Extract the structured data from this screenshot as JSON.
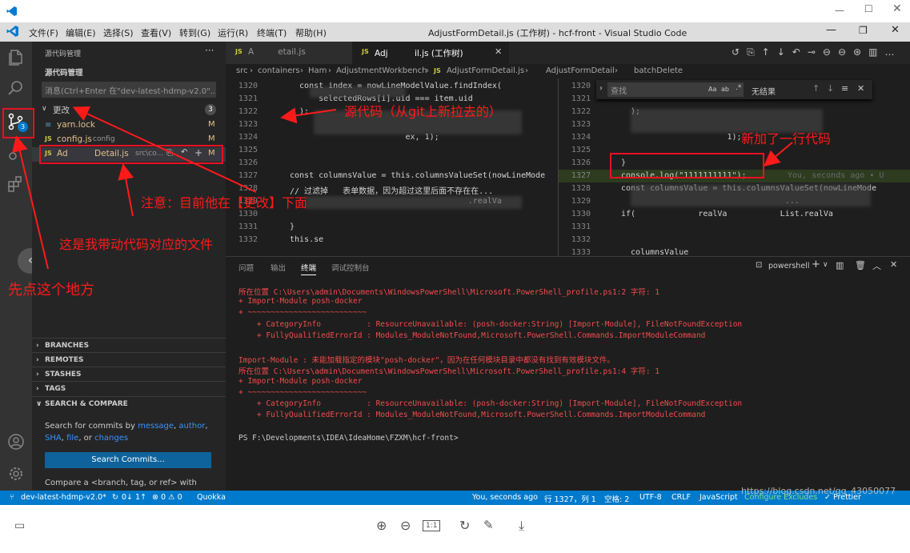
{
  "window": {
    "title": "AdjustFormDetail.js (工作树) - hcf-front - Visual Studio Code"
  },
  "menu": [
    "文件(F)",
    "编辑(E)",
    "选择(S)",
    "查看(V)",
    "转到(G)",
    "运行(R)",
    "终端(T)",
    "帮助(H)"
  ],
  "sidebar": {
    "title": "源代码管理",
    "section": "源代码管理",
    "message_placeholder": "消息(Ctrl+Enter 在\"dev-latest-hdmp-v2.0\"...",
    "changes_label": "更改",
    "changes_count": "3",
    "files": [
      {
        "name": "yarn.lock",
        "path": "",
        "status": "M"
      },
      {
        "name": "config.js",
        "path": "config",
        "status": "M"
      },
      {
        "name": "Ad          Detail.js",
        "path": "src\\co...",
        "status": "M"
      }
    ],
    "sections": [
      "BRANCHES",
      "REMOTES",
      "STASHES",
      "TAGS",
      "SEARCH & COMPARE"
    ],
    "search_text_1": "Search for commits by ",
    "search_links": [
      "message",
      "author",
      "SHA",
      "file",
      "changes"
    ],
    "search_button": "Search Commits...",
    "compare_text": "Compare a <branch, tag, or ref> with"
  },
  "tabs": [
    {
      "label": "A         etail.js",
      "icon": "JS"
    },
    {
      "label": "Adj          il.js (工作树)",
      "icon": "JS"
    }
  ],
  "breadcrumb": [
    "src",
    "containers",
    "Ham",
    "AdjustmentWorkbench",
    "AdjustFormDetail.js",
    "AdjustFormDetail",
    "batchDelete"
  ],
  "editor_left": {
    "lines": [
      {
        "n": "1320",
        "code": "  const index = nowLineModelValue.findIndex("
      },
      {
        "n": "1321",
        "code": "      selectedRows[i].uid === item.uid"
      },
      {
        "n": "1322",
        "code": "  );"
      },
      {
        "n": "1323",
        "code": ""
      },
      {
        "n": "1324",
        "code": "                        ex, 1);"
      },
      {
        "n": "1325",
        "code": ""
      },
      {
        "n": "1326",
        "code": ""
      },
      {
        "n": "1327",
        "code": "const columnsValue = this.columnsValueSet(nowLineMode"
      },
      {
        "n": "1328",
        "code": "// 过滤掉   表单数据，因为超过这里后面不存在在..."
      },
      {
        "n": "1329",
        "code": "                                     .realVa"
      },
      {
        "n": "1330",
        "code": ""
      },
      {
        "n": "1331",
        "code": "}"
      },
      {
        "n": "1332",
        "code": "this.se"
      }
    ]
  },
  "editor_right": {
    "find_placeholder": "查找",
    "find_result": "无结果",
    "lines": [
      {
        "n": "1320",
        "code": ""
      },
      {
        "n": "1321",
        "code": ""
      },
      {
        "n": "1322",
        "code": "  );"
      },
      {
        "n": "1323",
        "code": ""
      },
      {
        "n": "1324",
        "code": "                      1);"
      },
      {
        "n": "1325",
        "code": ""
      },
      {
        "n": "1326",
        "code": "}"
      },
      {
        "n": "1327",
        "code": "console.log(\"1111111111\");"
      },
      {
        "n": "1328",
        "code": "const columnsValue = this.columnsValueSet(nowLineMode"
      },
      {
        "n": "1329",
        "code": "                                  ..."
      },
      {
        "n": "1330",
        "code": "if(             realVa           List.realVa"
      },
      {
        "n": "1331",
        "code": ""
      },
      {
        "n": "1332",
        "code": ""
      },
      {
        "n": "1333",
        "code": "  columnsValue"
      }
    ],
    "inline_blame": "You, seconds ago • U"
  },
  "panel": {
    "tabs": [
      "问题",
      "输出",
      "终端",
      "调试控制台"
    ],
    "active_tab": "终端",
    "shell": "powershell",
    "terminal": [
      {
        "text": "所在位置 C:\\Users\\admin\\Documents\\WindowsPowerShell\\Microsoft.PowerShell_profile.ps1:2 字符: 1",
        "color": "#f14c4c"
      },
      {
        "text": "+ Import-Module posh-docker",
        "color": "#f14c4c"
      },
      {
        "text": "+ ~~~~~~~~~~~~~~~~~~~~~~~~~~",
        "color": "#f14c4c"
      },
      {
        "text": "    + CategoryInfo          : ResourceUnavailable: (posh-docker:String) [Import-Module], FileNotFoundException",
        "color": "#f14c4c"
      },
      {
        "text": "    + FullyQualifiedErrorId : Modules_ModuleNotFound,Microsoft.PowerShell.Commands.ImportModuleCommand",
        "color": "#f14c4c"
      },
      {
        "text": "",
        "color": "#f14c4c"
      },
      {
        "text": "Import-Module : 未能加载指定的模块\"posh-docker\"，因为在任何模块目录中都没有找到有效模块文件。",
        "color": "#f14c4c"
      },
      {
        "text": "所在位置 C:\\Users\\admin\\Documents\\WindowsPowerShell\\Microsoft.PowerShell_profile.ps1:4 字符: 1",
        "color": "#f14c4c"
      },
      {
        "text": "+ Import-Module posh-docker",
        "color": "#f14c4c"
      },
      {
        "text": "+ ~~~~~~~~~~~~~~~~~~~~~~~~~~",
        "color": "#f14c4c"
      },
      {
        "text": "    + CategoryInfo          : ResourceUnavailable: (posh-docker:String) [Import-Module], FileNotFoundException",
        "color": "#f14c4c"
      },
      {
        "text": "    + FullyQualifiedErrorId : Modules_ModuleNotFound,Microsoft.PowerShell.Commands.ImportModuleCommand",
        "color": "#f14c4c"
      },
      {
        "text": "",
        "color": "#cccccc"
      },
      {
        "text": "PS F:\\Developments\\IDEA\\IdeaHome\\FZXM\\hcf-front>",
        "color": "#cccccc"
      }
    ]
  },
  "statusbar": {
    "branch": "dev-latest-hdmp-v2.0*",
    "sync": "0↓ 1↑",
    "problems": "⊗ 0 ⚠ 0",
    "quokka": "Quokka",
    "blame": "You, seconds ago",
    "position": "行 1327，列 1",
    "spaces": "空格: 2",
    "encoding": "UTF-8",
    "eol": "CRLF",
    "language": "JavaScript",
    "configure": "Configure Excludes",
    "prettier": "✓ Prettier"
  },
  "annotations": {
    "source_code": "源代码（从git上新拉去的）",
    "new_line": "新加了一行代码",
    "notice": "注意：目前他在【更改】下面",
    "file": "这是我带动代码对应的文件",
    "click_here": "先点这个地方"
  },
  "watermark": "https://blog.csdn.net/qq_43050077",
  "colors": {
    "accent": "#007acc",
    "annotation": "#ff1a1a",
    "modified": "#e2c08d"
  }
}
